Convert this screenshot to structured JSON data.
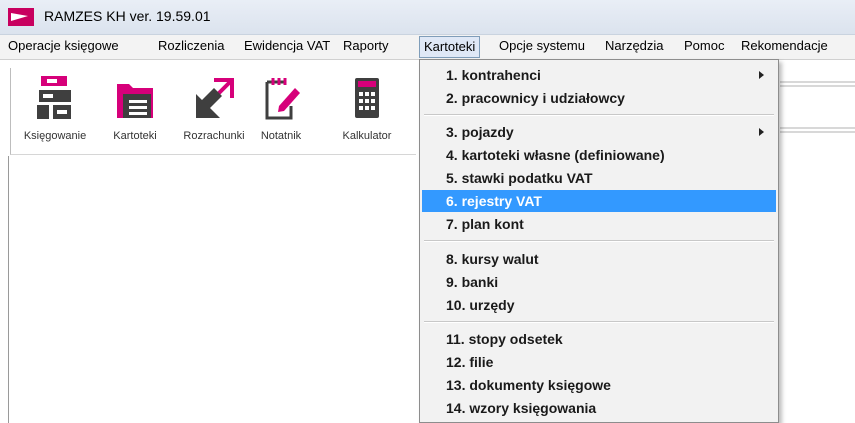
{
  "window": {
    "title": "RAMZES KH ver. 19.59.01",
    "logo_icon": "ramzes-logo-icon"
  },
  "menubar": {
    "items": [
      {
        "label": "Operacje księgowe"
      },
      {
        "label": "Rozliczenia"
      },
      {
        "label": "Ewidencja VAT"
      },
      {
        "label": "Raporty"
      },
      {
        "label": "Kartoteki",
        "active": true
      },
      {
        "label": "Opcje systemu"
      },
      {
        "label": "Narzędzia"
      },
      {
        "label": "Pomoc"
      },
      {
        "label": "Rekomendacje"
      }
    ]
  },
  "toolbar": {
    "items": [
      {
        "label": "Księgowanie",
        "icon": "ledger-binders-icon"
      },
      {
        "label": "Kartoteki",
        "icon": "folder-icon"
      },
      {
        "label": "Rozrachunki",
        "icon": "settlement-arrows-icon"
      },
      {
        "label": "Notatnik",
        "icon": "notepad-pencil-icon"
      },
      {
        "label": "Kalkulator",
        "icon": "calculator-icon"
      }
    ]
  },
  "dropdown": {
    "items": [
      {
        "label": "1. kontrahenci",
        "submenu": true
      },
      {
        "label": "2. pracownicy i udziałowcy"
      },
      {
        "label": "3. pojazdy",
        "submenu": true
      },
      {
        "label": "4. kartoteki własne (definiowane)"
      },
      {
        "label": "5. stawki podatku VAT"
      },
      {
        "label": "6. rejestry VAT",
        "selected": true
      },
      {
        "label": "7. plan kont"
      },
      {
        "label": "8. kursy walut"
      },
      {
        "label": "9. banki"
      },
      {
        "label": "10. urzędy"
      },
      {
        "label": "11. stopy odsetek"
      },
      {
        "label": "12. filie"
      },
      {
        "label": "13. dokumenty księgowe"
      },
      {
        "label": "14. wzory księgowania"
      }
    ]
  },
  "colors": {
    "accent": "#d6007a",
    "icon_dark": "#3f3f3f",
    "selection": "#3399ff",
    "menu_active": "#dfe8f6"
  }
}
